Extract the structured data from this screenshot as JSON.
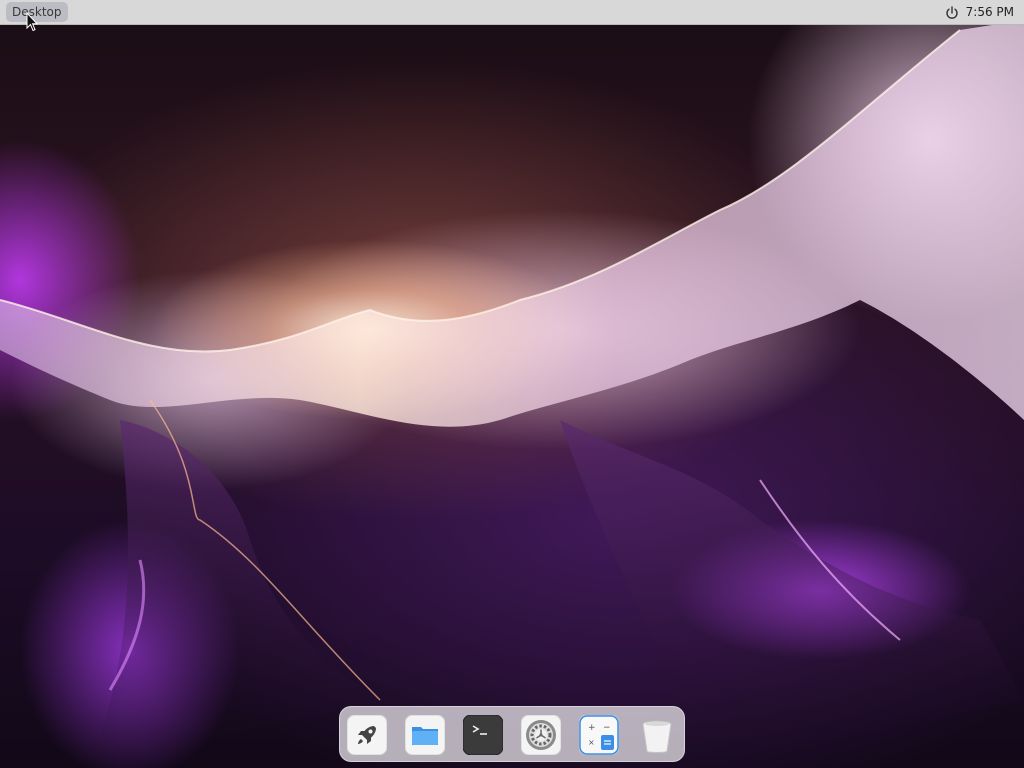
{
  "top_panel": {
    "desktop_label": "Desktop",
    "clock": "7:56 PM",
    "power_icon": "power-icon"
  },
  "dock": {
    "items": [
      {
        "name": "launcher",
        "icon": "rocket-icon"
      },
      {
        "name": "files",
        "icon": "folder-icon"
      },
      {
        "name": "terminal",
        "icon": "terminal-icon",
        "glyph": ">_"
      },
      {
        "name": "settings",
        "icon": "gear-icon"
      },
      {
        "name": "calculator",
        "icon": "calculator-icon"
      },
      {
        "name": "trash",
        "icon": "trash-icon"
      }
    ]
  },
  "colors": {
    "panel_bg": "#d8d8d8",
    "dock_bg": "#e1dee4",
    "accent_purple": "#a040f0",
    "folder_blue": "#4aa3f0"
  }
}
